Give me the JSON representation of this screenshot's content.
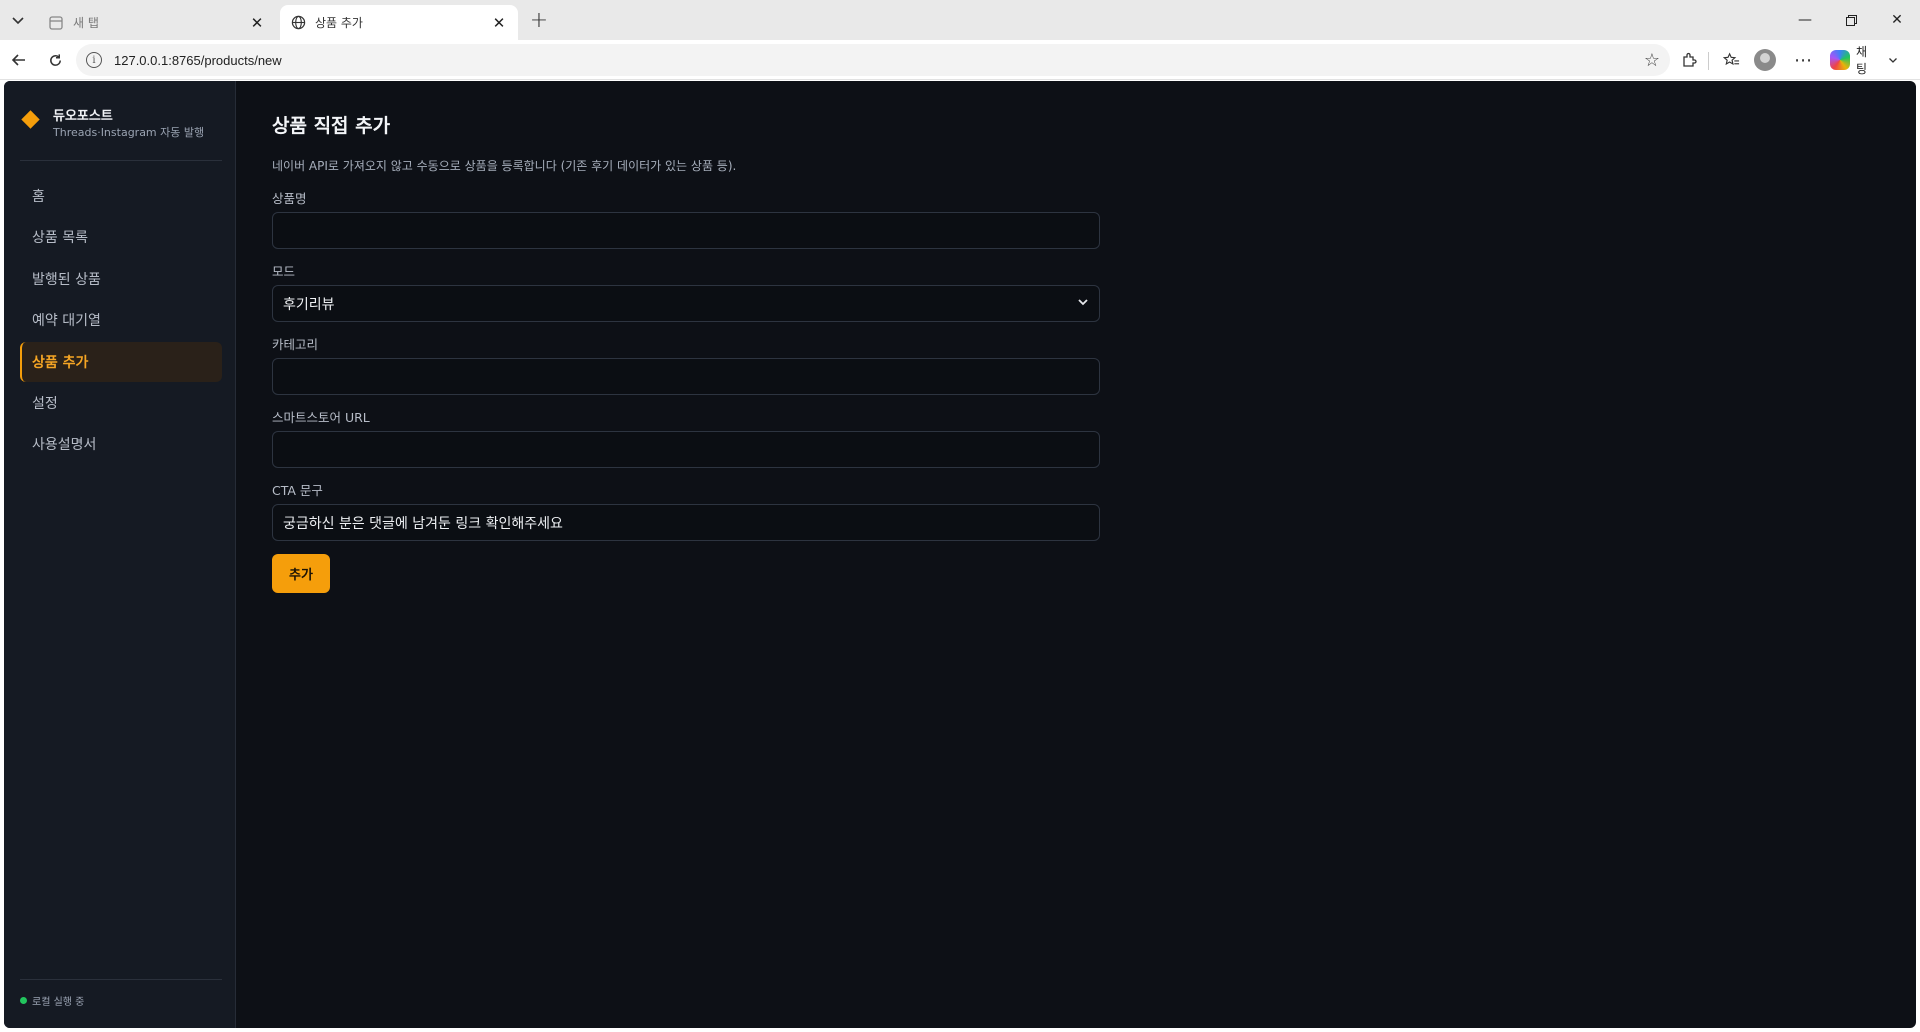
{
  "browser": {
    "tabs": [
      {
        "title": "새 탭",
        "active": false
      },
      {
        "title": "상품 추가",
        "active": true
      }
    ],
    "url": "127.0.0.1:8765/products/new",
    "chat_label": "채팅"
  },
  "brand": {
    "name": "듀오포스트",
    "subtitle": "Threads·Instagram 자동 발행",
    "accent": "#f59e0b"
  },
  "sidebar": {
    "items": [
      {
        "label": "홈",
        "active": false
      },
      {
        "label": "상품 목록",
        "active": false
      },
      {
        "label": "발행된 상품",
        "active": false
      },
      {
        "label": "예약 대기열",
        "active": false
      },
      {
        "label": "상품 추가",
        "active": true
      },
      {
        "label": "설정",
        "active": false
      },
      {
        "label": "사용설명서",
        "active": false
      }
    ],
    "status": "로컬 실행 중"
  },
  "form": {
    "title": "상품 직접 추가",
    "description": "네이버 API로 가져오지 않고 수동으로 상품을 등록합니다 (기존 후기 데이터가 있는 상품 등).",
    "fields": {
      "name": {
        "label": "상품명",
        "value": ""
      },
      "mode": {
        "label": "모드",
        "value": "후기리뷰"
      },
      "category": {
        "label": "카테고리",
        "value": ""
      },
      "url": {
        "label": "스마트스토어 URL",
        "value": ""
      },
      "cta": {
        "label": "CTA 문구",
        "value": "궁금하신 분은 댓글에 남겨둔 링크 확인해주세요"
      }
    },
    "submit_label": "추가"
  }
}
